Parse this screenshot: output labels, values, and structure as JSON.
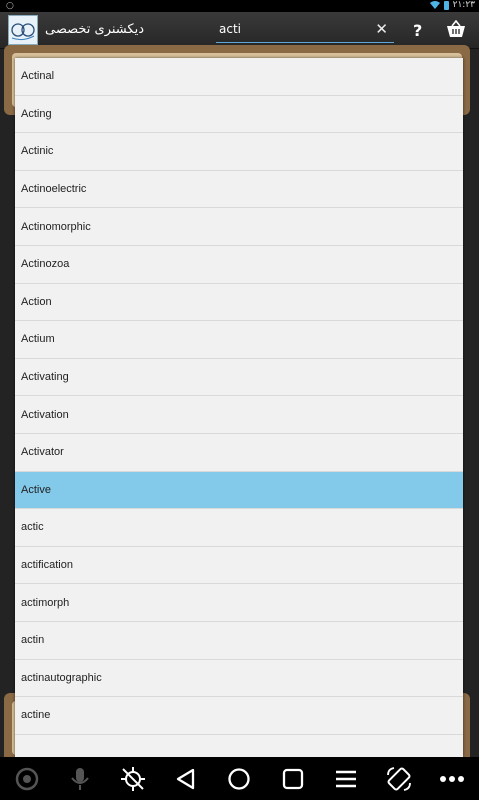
{
  "status_bar": {
    "time": "۲۱:۲۳"
  },
  "app": {
    "title": "دیکشنری تخصصی"
  },
  "search": {
    "value": "acti"
  },
  "words": [
    "Actinal",
    "Acting",
    "Actinic",
    "Actinoelectric",
    "Actinomorphic",
    "Actinozoa",
    "Action",
    "Actium",
    "Activating",
    "Activation",
    "Activator",
    "Active",
    "actic",
    "actification",
    "actimorph",
    "actin",
    "actinautographic",
    "actine"
  ],
  "selected_word": "Active",
  "colors": {
    "selected": "#82c9ea",
    "accent": "#5fa8d3"
  },
  "icons": {
    "app": "app-logo",
    "search_clear": "close-icon",
    "help": "question-icon",
    "store": "basket-icon",
    "nav": [
      "camera-icon",
      "mic-icon",
      "gps-off-icon",
      "back-icon",
      "home-icon",
      "recents-icon",
      "menu-icon",
      "rotate-icon",
      "more-icon"
    ]
  }
}
